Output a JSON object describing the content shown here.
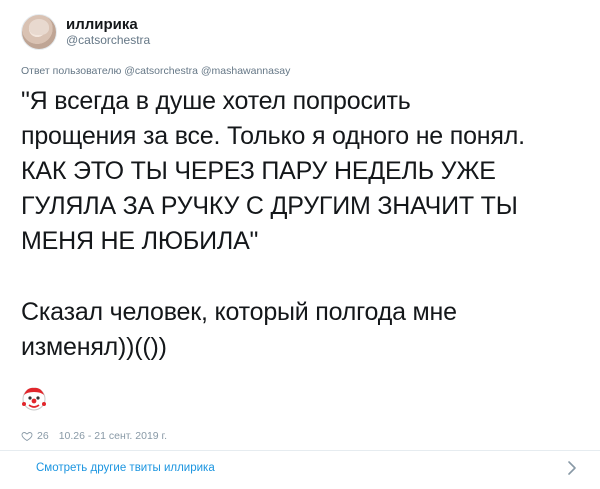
{
  "author": {
    "display_name": "иллирика",
    "handle": "@catsorchestra"
  },
  "reply": {
    "prefix": "Ответ пользователю",
    "mentions": "@catsorchestra @mashawannasay"
  },
  "tweet": {
    "line1": "\"Я всегда в душе хотел попросить",
    "line2": "прощения за все. Только я одного не понял.",
    "line3": "КАК ЭТО ТЫ ЧЕРЕЗ ПАРУ НЕДЕЛЬ УЖЕ",
    "line4": "ГУЛЯЛА ЗА РУЧКУ С ДРУГИМ ЗНАЧИТ ТЫ",
    "line5": "МЕНЯ НЕ ЛЮБИЛА\"",
    "line6": "Сказал человек, который полгода мне",
    "line7": "изменял))(())"
  },
  "meta": {
    "likes": "26",
    "timestamp": "10.26 - 21 сент. 2019 г."
  },
  "footer": {
    "more_link": "Смотреть другие твиты иллирика"
  },
  "icons": {
    "like": "heart-icon",
    "sticker": "clown-sticker-icon",
    "chevron": "chevron-right-icon"
  },
  "colors": {
    "link": "#1b95e0",
    "muted": "#657786",
    "text": "#14171a"
  }
}
